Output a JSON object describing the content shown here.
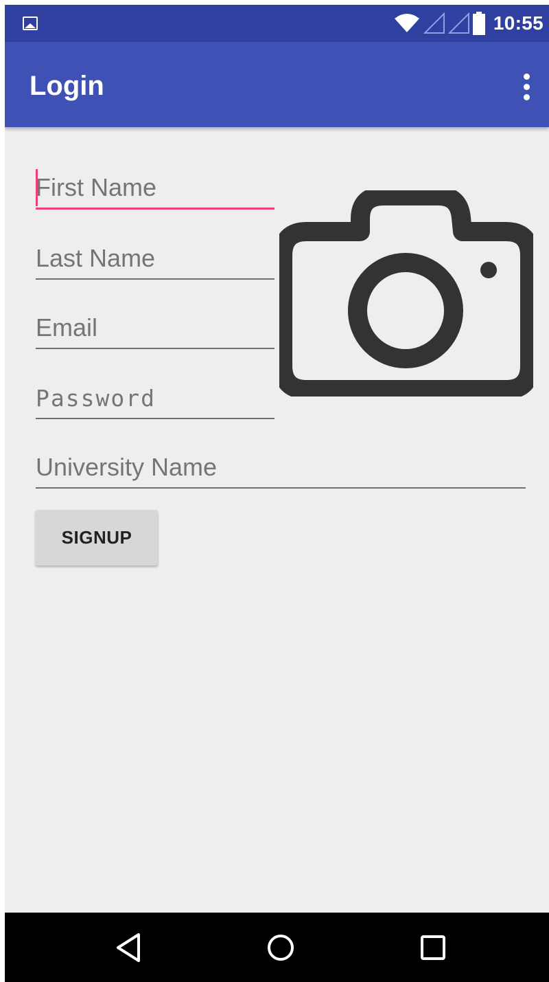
{
  "status_bar": {
    "notification_icon": "gallery-icon",
    "icons": [
      "wifi-icon",
      "signal-icon",
      "signal-icon",
      "battery-icon"
    ],
    "time": "10:55"
  },
  "app_bar": {
    "title": "Login",
    "menu_icon": "more-vert-icon"
  },
  "form": {
    "first_name": {
      "placeholder": "First Name",
      "value": ""
    },
    "last_name": {
      "placeholder": "Last Name",
      "value": ""
    },
    "email": {
      "placeholder": "Email",
      "value": ""
    },
    "password": {
      "placeholder": "Password",
      "value": ""
    },
    "university": {
      "placeholder": "University Name",
      "value": ""
    },
    "signup_label": "SIGNUP",
    "photo_icon": "camera-icon"
  },
  "nav_bar": {
    "back_icon": "back-icon",
    "home_icon": "home-icon",
    "recents_icon": "recents-icon"
  },
  "colors": {
    "status_bar": "#2f40a0",
    "app_bar": "#3f51b5",
    "accent": "#ec407a",
    "background": "#eeeeee",
    "camera": "#333333"
  }
}
